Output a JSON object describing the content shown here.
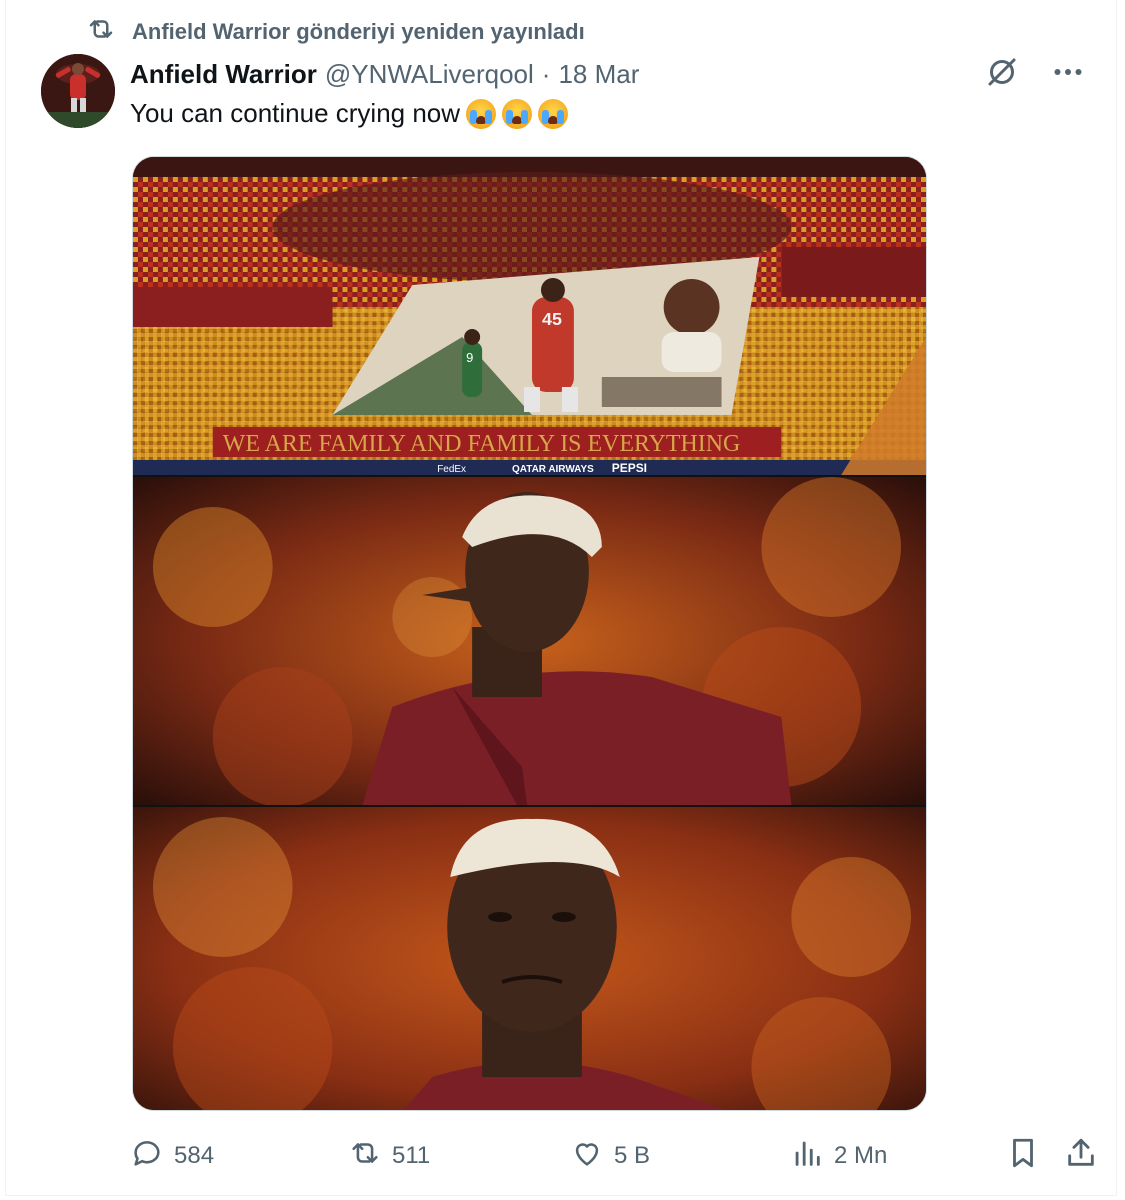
{
  "repost_banner": {
    "text": "Anfield Warrior gönderiyi yeniden yayınladı",
    "icon": "repost-icon"
  },
  "tweet": {
    "author_name": "Anfield Warrior",
    "handle": "@YNWALiverqool",
    "separator": "·",
    "date": "18 Mar",
    "text": "You can continue crying now",
    "emojis": [
      "loudly-crying-face",
      "loudly-crying-face",
      "loudly-crying-face"
    ]
  },
  "media": {
    "banner_text": "WE ARE FAMILY AND FAMILY IS EVERYTHING",
    "jersey_number": "45",
    "small_jersey_number": "9",
    "sponsor_texts": [
      "FedEx",
      "QATAR AIRWAYS",
      "PEPSI"
    ],
    "icon_names": [
      "grok-icon",
      "more-icon"
    ]
  },
  "actions": {
    "replies": "584",
    "reposts": "511",
    "likes": "5 B",
    "views": "2 Mn"
  },
  "colors": {
    "text_primary": "#0f1419",
    "text_secondary": "#536471",
    "border": "#cfd9de",
    "stadium_red": "#8b1e1e",
    "stadium_yellow": "#d9a020"
  }
}
